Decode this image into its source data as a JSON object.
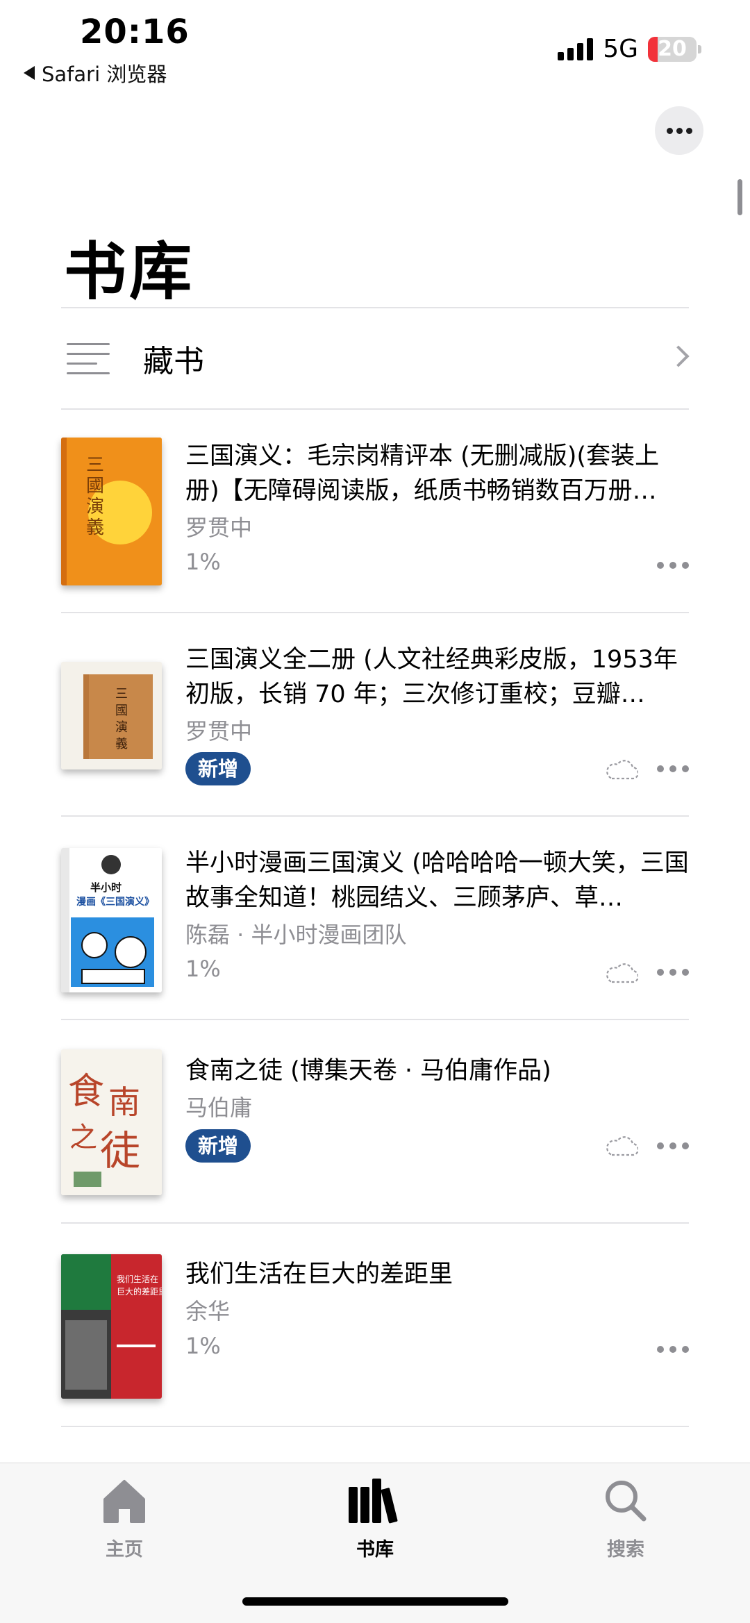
{
  "status_bar": {
    "time": "20:16",
    "back_app": "Safari 浏览器",
    "network": "5G",
    "battery": "20",
    "battery_level": 0.2
  },
  "header": {
    "title": "书库",
    "more_icon": "ellipsis-icon"
  },
  "collection": {
    "label": "藏书",
    "icon": "list-icon"
  },
  "books": [
    {
      "title": "三国演义：毛宗岗精评本 (无删减版)(套装上册)【无障碍阅读版，纸质书畅销数百万册…",
      "author": "罗贯中",
      "status": "1%",
      "is_new": false,
      "cloud": false
    },
    {
      "title": "三国演义全二册 (人文社经典彩皮版，1953年初版，长销 70 年；三次修订重校；豆瓣…",
      "author": "罗贯中",
      "status": "新增",
      "is_new": true,
      "cloud": true
    },
    {
      "title": "半小时漫画三国演义 (哈哈哈哈一顿大笑，三国故事全知道！桃园结义、三顾茅庐、草…",
      "author": "陈磊 · 半小时漫画团队",
      "status": "1%",
      "is_new": false,
      "cloud": true
    },
    {
      "title": "食南之徒 (博集天卷 · 马伯庸作品)",
      "author": "马伯庸",
      "status": "新增",
      "is_new": true,
      "cloud": true
    },
    {
      "title": "我们生活在巨大的差距里",
      "author": "余华",
      "status": "1%",
      "is_new": false,
      "cloud": false
    }
  ],
  "tab_bar": {
    "tabs": [
      {
        "label": "主页",
        "icon": "home-icon",
        "active": false
      },
      {
        "label": "书库",
        "icon": "library-icon",
        "active": true
      },
      {
        "label": "搜索",
        "icon": "search-icon",
        "active": false
      }
    ]
  },
  "colors": {
    "badge_new": "#1f4f8f",
    "secondary_text": "#8e8e93",
    "battery_low": "#f2323a"
  }
}
